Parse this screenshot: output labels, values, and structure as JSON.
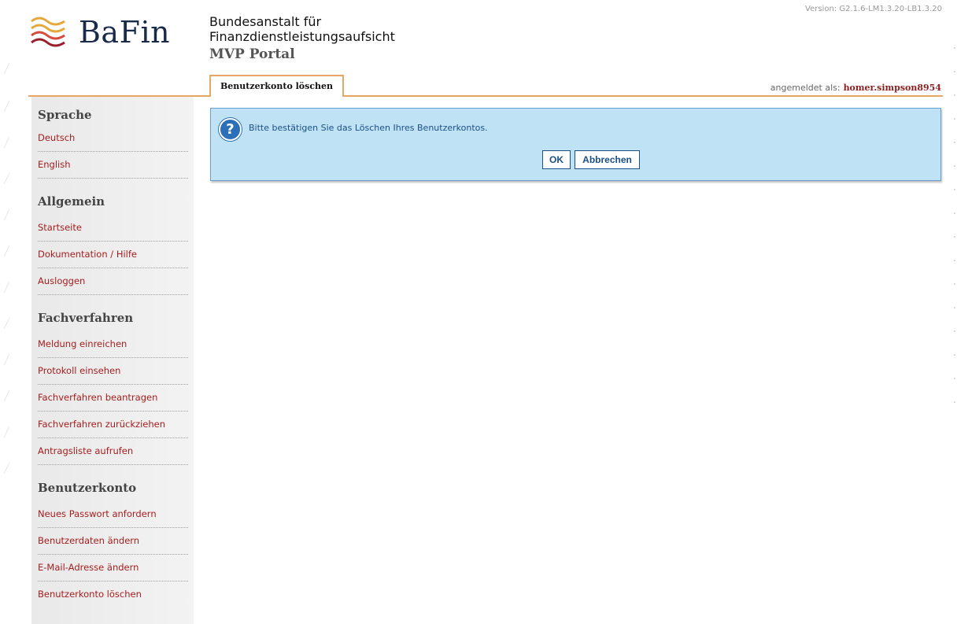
{
  "header": {
    "logo_text": "BaFin",
    "agency_line1": "Bundesanstalt für",
    "agency_line2": "Finanzdienstleistungsaufsicht",
    "portal": "MVP Portal",
    "version": "Version: G2.1.6-LM1.3.20-LB1.3.20"
  },
  "tabs": {
    "active": "Benutzerkonto löschen"
  },
  "login": {
    "label": "angemeldet als:",
    "user": "homer.simpson8954"
  },
  "sidebar": {
    "sections": [
      {
        "title": "Sprache",
        "items": [
          "Deutsch",
          "English"
        ]
      },
      {
        "title": "Allgemein",
        "items": [
          "Startseite",
          "Dokumentation / Hilfe",
          "Ausloggen"
        ]
      },
      {
        "title": "Fachverfahren",
        "items": [
          "Meldung einreichen",
          "Protokoll einsehen",
          "Fachverfahren beantragen",
          "Fachverfahren zurückziehen",
          "Antragsliste aufrufen"
        ]
      },
      {
        "title": "Benutzerkonto",
        "items": [
          "Neues Passwort anfordern",
          "Benutzerdaten ändern",
          "E-Mail-Adresse ändern",
          "Benutzerkonto löschen"
        ]
      }
    ]
  },
  "dialog": {
    "icon": "question-icon",
    "message": "Bitte bestätigen Sie das Löschen Ihres Benutzerkontos.",
    "ok_label": "OK",
    "cancel_label": "Abbrechen"
  },
  "colors": {
    "accent_orange": "#e8a664",
    "link_red": "#a51e1e",
    "dialog_bg": "#bfe3f5",
    "dialog_text": "#1b4f86"
  }
}
